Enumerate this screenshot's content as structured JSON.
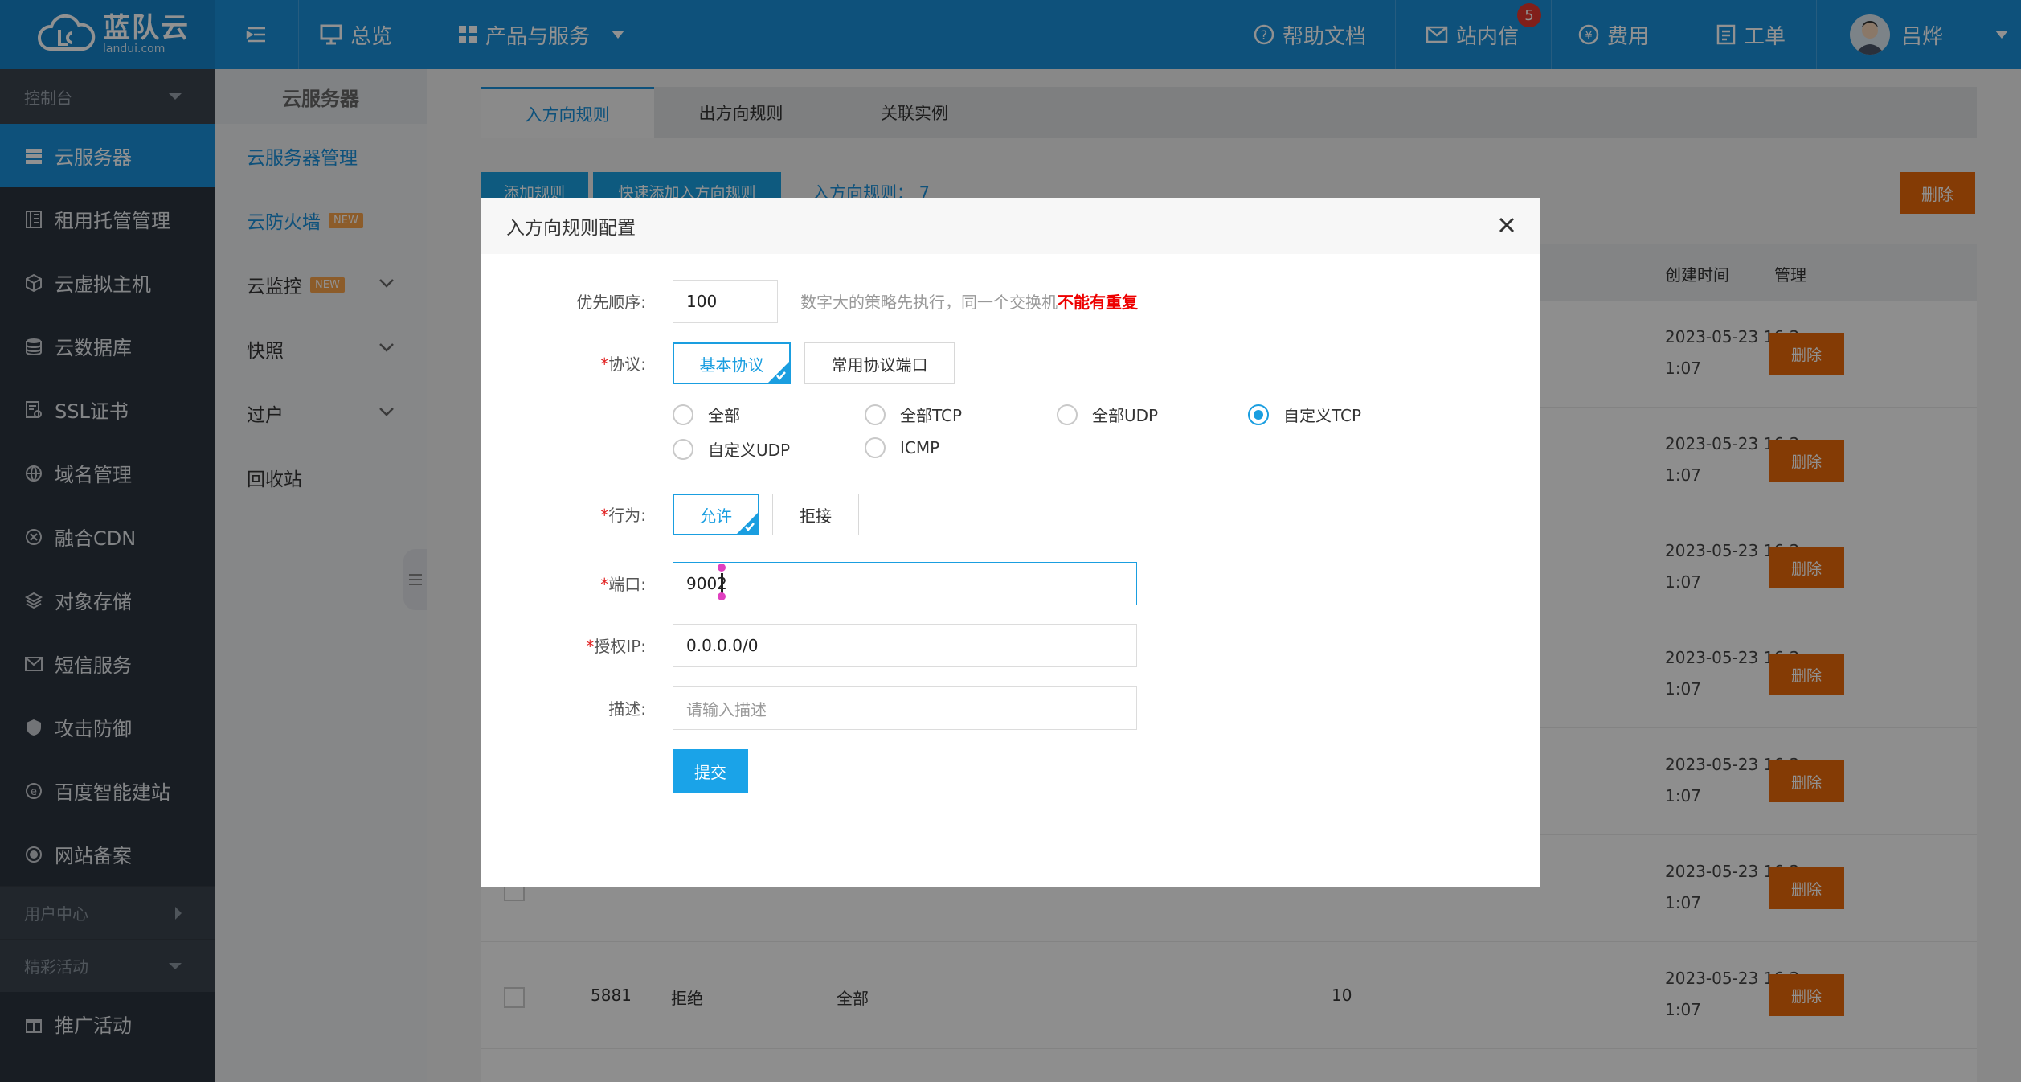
{
  "topbar": {
    "brand_cn": "蓝队云",
    "brand_en": "landui.com",
    "overview": "总览",
    "products": "产品与服务",
    "help": "帮助文档",
    "messages": "站内信",
    "message_count": "5",
    "billing": "费用",
    "tickets": "工单",
    "user": "吕烨"
  },
  "sidebar": {
    "console": "控制台",
    "items": [
      {
        "label": "云服务器",
        "icon": "server-icon"
      },
      {
        "label": "租用托管管理",
        "icon": "rack-icon"
      },
      {
        "label": "云虚拟主机",
        "icon": "cube-icon"
      },
      {
        "label": "云数据库",
        "icon": "database-icon"
      },
      {
        "label": "SSL证书",
        "icon": "certificate-icon"
      },
      {
        "label": "域名管理",
        "icon": "globe-icon"
      },
      {
        "label": "融合CDN",
        "icon": "cdn-icon"
      },
      {
        "label": "对象存储",
        "icon": "layers-icon"
      },
      {
        "label": "短信服务",
        "icon": "mail-icon"
      },
      {
        "label": "攻击防御",
        "icon": "shield-icon"
      },
      {
        "label": "百度智能建站",
        "icon": "site-icon"
      },
      {
        "label": "网站备案",
        "icon": "record-icon"
      }
    ],
    "user_center": "用户中心",
    "activities": "精彩活动",
    "promo": "推广活动"
  },
  "subnav": {
    "title": "云服务器",
    "items": [
      {
        "label": "云服务器管理"
      },
      {
        "label": "云防火墙",
        "badge": "NEW"
      },
      {
        "label": "云监控",
        "badge": "NEW"
      },
      {
        "label": "快照"
      },
      {
        "label": "过户"
      },
      {
        "label": "回收站"
      }
    ]
  },
  "tabs": [
    "入方向规则",
    "出方向规则",
    "关联实例"
  ],
  "toolbar": {
    "add": "添加规则",
    "quick_add": "快速添加入方向规则",
    "count": "入方向规则： 7",
    "delete": "删除"
  },
  "table": {
    "headers": {
      "created": "创建时间",
      "manage": "管理"
    },
    "rows": [
      {
        "created": [
          "2023-05-23 16:2",
          "1:07"
        ],
        "action": "删除"
      },
      {
        "created": [
          "2023-05-23 16:2",
          "1:07"
        ],
        "action": "删除"
      },
      {
        "created": [
          "2023-05-23 16:2",
          "1:07"
        ],
        "action": "删除"
      },
      {
        "created": [
          "2023-05-23 16:2",
          "1:07"
        ],
        "action": "删除"
      },
      {
        "created": [
          "2023-05-23 16:2",
          "1:07"
        ],
        "action": "删除"
      },
      {
        "created": [
          "2023-05-23 16:2",
          "1:07"
        ],
        "action": "删除"
      },
      {
        "port": "5881",
        "behavior": "拒绝",
        "protocol": "全部",
        "priority": "10",
        "created": [
          "2023-05-23 16:2",
          "1:07"
        ],
        "action": "删除"
      }
    ]
  },
  "modal": {
    "title": "入方向规则配置",
    "priority_label": "优先顺序:",
    "priority_value": "100",
    "priority_hint": "数字大的策略先执行，同一个交换机",
    "priority_hint_strong": "不能有重复",
    "protocol_label": "协议:",
    "protocol_tabs": [
      "基本协议",
      "常用协议端口"
    ],
    "protocol_options": [
      "全部",
      "全部TCP",
      "全部UDP",
      "自定义TCP",
      "自定义UDP",
      "ICMP"
    ],
    "protocol_selected": "自定义TCP",
    "action_label": "行为:",
    "action_options": [
      "允许",
      "拒接"
    ],
    "port_label": "端口:",
    "port_value": "9002",
    "ip_label": "授权IP:",
    "ip_value": "0.0.0.0/0",
    "desc_label": "描述:",
    "desc_placeholder": "请输入描述",
    "submit": "提交"
  }
}
